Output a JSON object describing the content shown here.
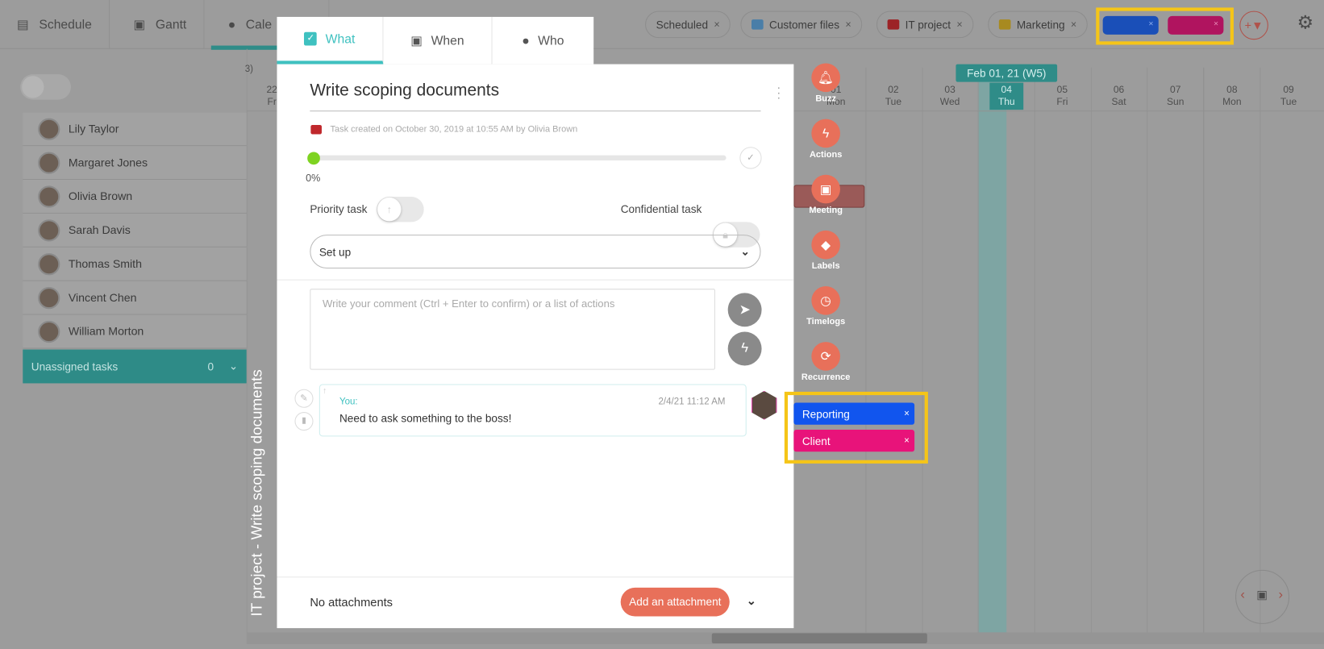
{
  "nav": {
    "tabs": [
      {
        "label": "Schedule",
        "icon": "calendar-list-icon"
      },
      {
        "label": "Gantt",
        "icon": "calendar-icon"
      },
      {
        "label": "Cale",
        "icon": "user-circle-icon",
        "active": true
      }
    ]
  },
  "filters": {
    "chips": [
      {
        "label": "Scheduled"
      },
      {
        "label": "Customer files",
        "color": "#4a8fc4"
      },
      {
        "label": "IT project",
        "color": "#c0282c"
      },
      {
        "label": "Marketing",
        "color": "#c9a21b"
      }
    ],
    "tag_filters": [
      {
        "color": "#1a4fb8"
      },
      {
        "color": "#b0145f"
      }
    ],
    "close": "×"
  },
  "sidebar": {
    "people": [
      "Lily Taylor",
      "Margaret Jones",
      "Olivia Brown",
      "Sarah Davis",
      "Thomas Smith",
      "Vincent Chen",
      "William Morton"
    ],
    "unassigned": {
      "label": "Unassigned tasks",
      "count": "0"
    }
  },
  "calendar": {
    "partial_week": "3)",
    "week_label": "Feb 01, 21 (W5)",
    "days": [
      {
        "n": "22",
        "d": "Fr"
      },
      {
        "n": "01",
        "d": "Mon"
      },
      {
        "n": "02",
        "d": "Tue"
      },
      {
        "n": "03",
        "d": "Wed"
      },
      {
        "n": "04",
        "d": "Thu",
        "today": true
      },
      {
        "n": "05",
        "d": "Fri"
      },
      {
        "n": "06",
        "d": "Sat"
      },
      {
        "n": "07",
        "d": "Sun"
      },
      {
        "n": "08",
        "d": "Mon"
      },
      {
        "n": "09",
        "d": "Tue"
      }
    ]
  },
  "vertical_title": "IT project - Write scoping documents",
  "modal": {
    "tabs": [
      {
        "label": "What",
        "icon": "clipboard-check-icon",
        "active": true
      },
      {
        "label": "When",
        "icon": "calendar-icon"
      },
      {
        "label": "Who",
        "icon": "user-circle-icon"
      }
    ],
    "title": "Write scoping documents",
    "created": "Task created on October 30, 2019 at 10:55 AM by Olivia Brown",
    "progress": {
      "value": 0,
      "label": "0%"
    },
    "priority_label": "Priority task",
    "priority_on": false,
    "confidential_label": "Confidential task",
    "confidential_on": false,
    "status": "Set up",
    "comment_placeholder": "Write your comment (Ctrl + Enter to confirm) or a list of actions",
    "comment": {
      "author": "You:",
      "time": "2/4/21 11:12 AM",
      "text": "Need to ask something to the boss!"
    },
    "attachments": "No attachments",
    "add_attachment": "Add an attachment"
  },
  "actions": [
    {
      "label": "Buzz",
      "icon": "bell-icon"
    },
    {
      "label": "Actions",
      "icon": "lightning-icon"
    },
    {
      "label": "Meeting",
      "icon": "calendar-icon"
    },
    {
      "label": "Labels",
      "icon": "tag-icon"
    },
    {
      "label": "Timelogs",
      "icon": "clock-icon"
    },
    {
      "label": "Recurrence",
      "icon": "sync-icon"
    }
  ],
  "tags": [
    {
      "label": "Reporting",
      "color": "#1155ee"
    },
    {
      "label": "Client",
      "color": "#e8137a"
    }
  ],
  "colors": {
    "accent": "#3fc1c0",
    "highlight": "#f5c518",
    "action": "#e8705a"
  }
}
